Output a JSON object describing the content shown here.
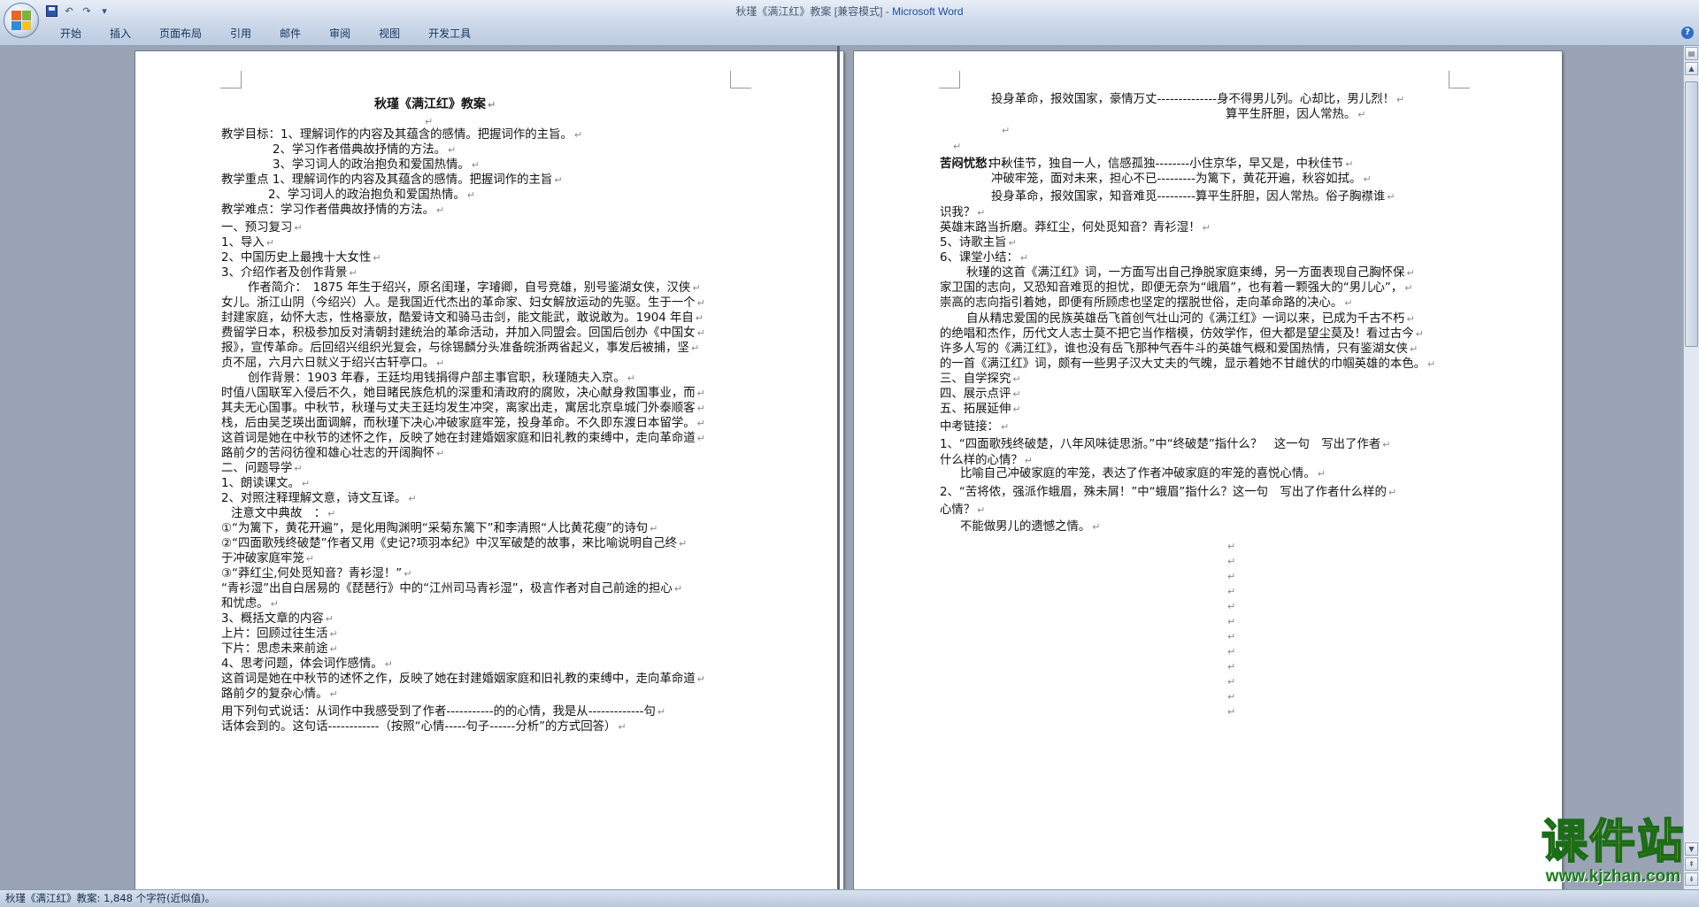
{
  "window": {
    "title_doc": "秋瑾《满江红》教案 [兼容模式] - ",
    "title_app": "Microsoft Word"
  },
  "quick_access": [
    "save-icon",
    "undo-icon",
    "redo-icon",
    "customize-icon"
  ],
  "ribbon": {
    "tabs": [
      "开始",
      "插入",
      "页面布局",
      "引用",
      "邮件",
      "审阅",
      "视图",
      "开发工具"
    ]
  },
  "page1": {
    "lines": [
      "秋瑾《满江红》教案",
      "",
      "教学目标：1、理解词作的内容及其蕴含的感情。把握词作的主旨。",
      "2、学习作者借典故抒情的方法。",
      "3、学习词人的政治抱负和爱国热情。",
      "教学重点 1、理解词作的内容及其蕴含的感情。把握词作的主旨",
      "2、学习词人的政治抱负和爱国热情。",
      "教学难点：学习作者借典故抒情的方法。",
      "一、预习复习",
      "1、导入",
      "2、中国历史上最拽十大女性",
      "3、介绍作者及创作背景",
      "作者简介：　1875 年生于绍兴，原名闺瑾，字璿卿，自号竞雄，别号鉴湖女侠，汉侠",
      "女儿。浙江山阴（今绍兴）人。是我国近代杰出的革命家、妇女解放运动的先驱。生于一个",
      "封建家庭，幼怀大志，性格豪放，酷爱诗文和骑马击剑，能文能武，敢说敢为。1904 年自",
      "费留学日本，积极参加反对清朝封建统治的革命活动，并加入同盟会。回国后创办《中国女",
      "报》，宣传革命。后回绍兴组织光复会，与徐锡麟分头准备皖浙两省起义，事发后被捕，坚",
      "贞不屈，六月六日就义于绍兴古轩亭口。",
      "创作背景：1903 年春，王廷均用钱捐得户部主事官职，秋瑾随夫入京。",
      "时值八国联军入侵后不久，她目睹民族危机的深重和清政府的腐败，决心献身救国事业，而",
      "其夫无心国事。中秋节，秋瑾与丈夫王廷均发生冲突，离家出走，寓居北京阜城门外泰顺客",
      "栈，后由吴芝瑛出面调解，而秋瑾下决心冲破家庭牢笼，投身革命。不久即东渡日本留学。",
      "这首词是她在中秋节的述怀之作，反映了她在封建婚姻家庭和旧礼教的束缚中，走向革命道",
      "路前夕的苦闷彷徨和雄心壮志的开阔胸怀",
      "二、问题导学",
      "1、朗读课文。",
      "2、对照注释理解文意，诗文互译。",
      "注意文中典故　：",
      "①“为篱下，黄花开遍”，是化用陶渊明“采菊东篱下”和李清照“人比黄花瘦”的诗句",
      "②“四面歌残终破楚”作者又用《史记?项羽本纪》中汉军破楚的故事，来比喻说明自己终",
      "于冲破家庭牢笼",
      "③“莽红尘,何处觅知音？青衫湿！”",
      "“青衫湿”出自白居易的《琵琶行》中的“江州司马青衫湿”，极言作者对自己前途的担心",
      "和忧虑。",
      "3、概括文章的内容",
      "上片：回顾过往生活",
      "下片：思虑未来前途",
      "4、思考问题，体会词作感情。",
      "这首词是她在中秋节的述怀之作，反映了她在封建婚姻家庭和旧礼教的束缚中，走向革命道",
      "路前夕的复杂心情。",
      "用下列句式说话：从词作中我感受到了作者-----------的的心情，我是从-------------句",
      "话体会到的。这句话------------（按照“心情-----句子------分析”的方式回答）"
    ]
  },
  "page2": {
    "lines": [
      "投身革命，报效国家，豪情万丈--------------身不得男儿列。心却比，男儿烈！",
      "算平生肝胆，因人常热。",
      "",
      "",
      "苦闷忧愁：",
      "中秋佳节，独自一人，信感孤独--------小住京华，早又是，中秋佳节",
      "冲破牢笼，面对未来，担心不已---------为篱下，黄花开遍，秋容如拭。",
      "投身革命，报效国家，知音难觅---------算平生肝胆，因人常热。俗子胸襟谁",
      "识我？",
      "英雄末路当折磨。莽红尘，何处觅知音？青衫湿！",
      "5、诗歌主旨",
      "6、课堂小结：",
      "秋瑾的这首《满江红》词，一方面写出自己挣脱家庭束缚，另一方面表现自己胸怀保",
      "家卫国的志向，又恐知音难觅的担忧，即便无奈为“峨眉”，也有着一颗强大的“男儿心”，",
      "崇高的志向指引着她，即便有所顾虑也坚定的摆脱世俗，走向革命路的决心。",
      "自从精忠爱国的民族英雄岳飞首创气壮山河的《满江红》一词以来，已成为千古不朽",
      "的绝唱和杰作，历代文人志士莫不把它当作楷模，仿效学作，但大都是望尘莫及！看过古今",
      "许多人写的《满江红》，谁也没有岳飞那种气吞牛斗的英雄气概和爱国热情，只有鉴湖女侠",
      "的一首《满江红》词，颇有一些男子汉大丈夫的气魄，显示着她不甘雌伏的巾帼英雄的本色。",
      "三、自学探究",
      "四、展示点评",
      "五、拓展延伸",
      "中考链接：",
      "1、“四面歌残终破楚，八年风味徒思浙。”中“终破楚”指什么？　这一句　写出了作者",
      "什么样的心情？",
      "比喻自己冲破家庭的牢笼，表达了作者冲破家庭的牢笼的喜悦心情。",
      "2、“苦将侬，强派作蛾眉，殊未屑！”中“蛾眉”指什么？这一句　写出了作者什么样的",
      "心情？",
      "不能做男儿的遗憾之情。"
    ]
  },
  "status": {
    "text": "秋瑾《满江红》教案: 1,848 个字符(近似值)。"
  },
  "watermark": {
    "big": "课件站",
    "url": "www.kjzhan.com"
  }
}
